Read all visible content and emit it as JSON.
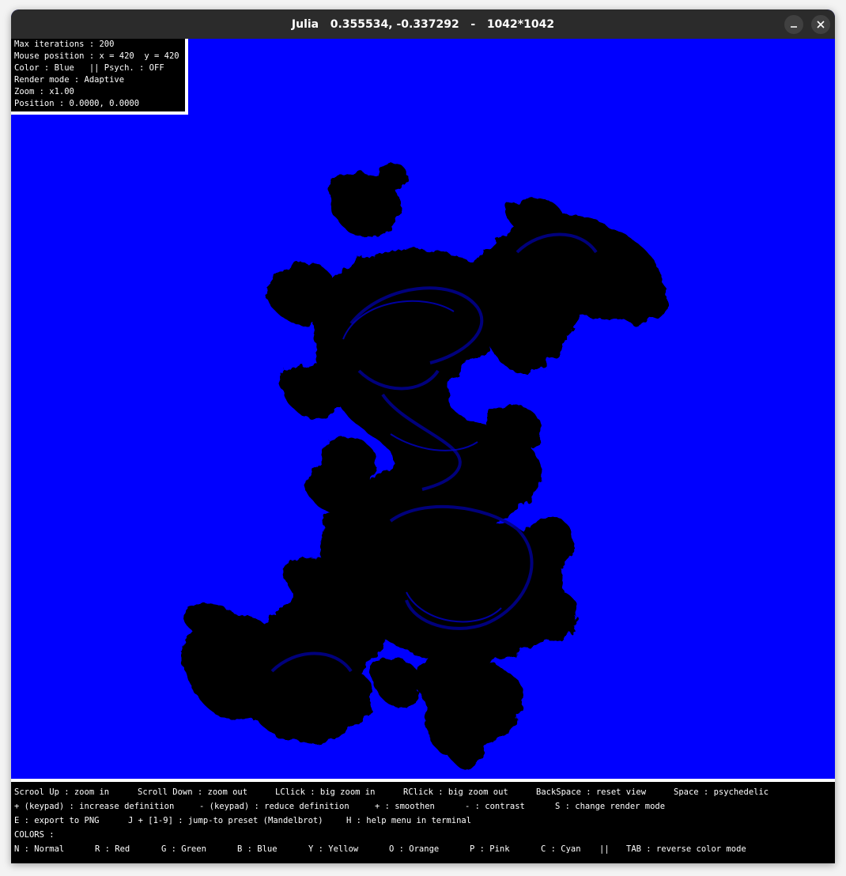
{
  "window": {
    "title": "Julia   0.355534, -0.337292   -   1042*1042",
    "minimize_icon": "minimize-icon",
    "close_icon": "close-icon"
  },
  "info_panel": {
    "lines": [
      "Max iterations : 200",
      "Mouse position : x = 420  y = 420",
      "Color : Blue   || Psych. : OFF",
      "Render mode : Adaptive",
      "Zoom : x1.00",
      "Position : 0.0000, 0.0000"
    ]
  },
  "colors": {
    "background": "#0000ff",
    "fractal": "#000000",
    "fractal_edge": "#00008a",
    "panel": "#000000",
    "panel_text": "#ffffff",
    "titlebar": "#2b2b2b"
  },
  "help": {
    "row1": [
      "Scrool Up : zoom in",
      "Scroll Down : zoom out",
      "LClick : big zoom in",
      "RClick : big zoom out",
      "BackSpace : reset view",
      "Space : psychedelic"
    ],
    "row2": [
      "+ (keypad) : increase definition",
      "- (keypad) : reduce definition",
      "+ : smoothen",
      "- : contrast",
      "S : change render mode"
    ],
    "row3": [
      "E : export to PNG",
      "J + [1-9] : jump-to preset (Mandelbrot)",
      "H : help menu in terminal"
    ],
    "row4": [
      "COLORS :"
    ],
    "row5": [
      "N : Normal",
      "R : Red",
      "G : Green",
      "B : Blue",
      "Y : Yellow",
      "O : Orange",
      "P : Pink",
      "C : Cyan",
      "||",
      "TAB : reverse color mode"
    ]
  }
}
